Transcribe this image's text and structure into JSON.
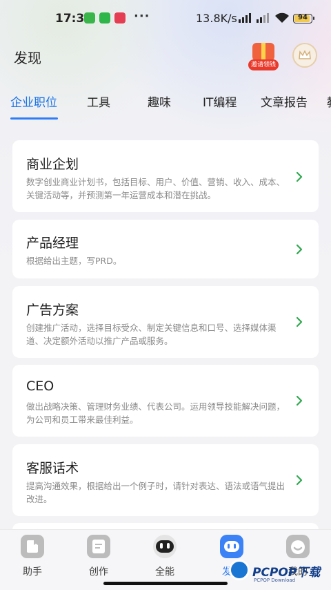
{
  "status_bar": {
    "time": "17:31",
    "speed": "13.8K/s",
    "battery": "94",
    "more_dots": "···",
    "icons": [
      "shield-app-icon",
      "wechat-pay-icon",
      "heart-app-icon",
      "signal-hd-icon",
      "signal-hd-icon",
      "wifi-icon",
      "battery-icon"
    ]
  },
  "header": {
    "title": "发现",
    "invite_label": "邀请领钱"
  },
  "tabs": [
    {
      "label": "企业职位",
      "active": true
    },
    {
      "label": "工具",
      "active": false
    },
    {
      "label": "趣味",
      "active": false
    },
    {
      "label": "IT编程",
      "active": false
    },
    {
      "label": "文章报告",
      "active": false
    },
    {
      "label": "教",
      "active": false
    }
  ],
  "cards": [
    {
      "title": "商业企划",
      "desc": "数字创业商业计划书，包括目标、用户、价值、营销、收入、成本、关键活动等，并预测第一年运营成本和潜在挑战。"
    },
    {
      "title": "产品经理",
      "desc": "根据给出主题，写PRD。"
    },
    {
      "title": "广告方案",
      "desc": "创建推广活动，选择目标受众、制定关键信息和口号、选择媒体渠道、决定额外活动以推广产品或服务。"
    },
    {
      "title": "CEO",
      "desc": "做出战略决策、管理财务业绩、代表公司。运用领导技能解决问题，为公司和员工带来最佳利益。"
    },
    {
      "title": "客服话术",
      "desc": "提高沟通效果，根据给出一个例子时，请针对表达、语法或语气提出改进。"
    }
  ],
  "bottom_nav": [
    {
      "label": "助手",
      "icon": "assistant-icon"
    },
    {
      "label": "创作",
      "icon": "create-icon"
    },
    {
      "label": "全能",
      "icon": "robot-icon"
    },
    {
      "label": "发现",
      "icon": "discover-icon"
    },
    {
      "label": "我的",
      "icon": "profile-icon"
    }
  ],
  "watermark": {
    "text": "PCPOP下载",
    "sub": "PCPOP Download"
  },
  "colors": {
    "accent": "#2e7cf6",
    "chevron": "#2fa84f"
  }
}
